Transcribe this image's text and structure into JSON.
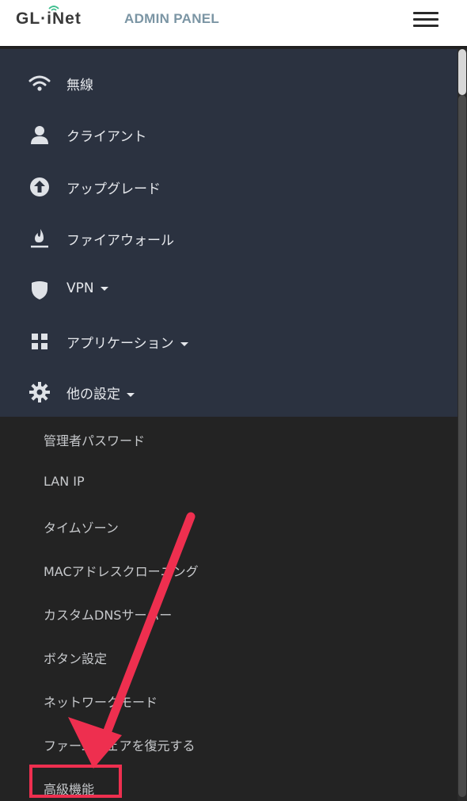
{
  "header": {
    "logo_text": "GL·iNet",
    "title": "ADMIN PANEL",
    "menu_icon": "hamburger-menu-icon"
  },
  "nav": {
    "items": [
      {
        "label": "無線",
        "icon": "wifi-icon"
      },
      {
        "label": "クライアント",
        "icon": "user-icon"
      },
      {
        "label": "アップグレード",
        "icon": "upload-circle-icon"
      },
      {
        "label": "ファイアウォール",
        "icon": "flame-icon"
      },
      {
        "label": "VPN",
        "icon": "shield-icon",
        "has_dropdown": true
      },
      {
        "label": "アプリケーション",
        "icon": "grid-icon",
        "has_dropdown": true
      },
      {
        "label": "他の設定",
        "icon": "gear-icon",
        "has_dropdown": true
      }
    ],
    "submenu": [
      {
        "label": "管理者パスワード"
      },
      {
        "label": "LAN IP"
      },
      {
        "label": "タイムゾーン"
      },
      {
        "label": "MACアドレスクローニング"
      },
      {
        "label": "カスタムDNSサーバー"
      },
      {
        "label": "ボタン設定"
      },
      {
        "label": "ネットワークモード"
      },
      {
        "label": "ファームウェアを復元する"
      },
      {
        "label": "高級機能"
      }
    ]
  },
  "colors": {
    "header_bg": "#ffffff",
    "nav_bg": "#2b3240",
    "submenu_bg": "#232323",
    "title_color": "#7b95a4",
    "annotation_red": "#ee2f4f"
  }
}
